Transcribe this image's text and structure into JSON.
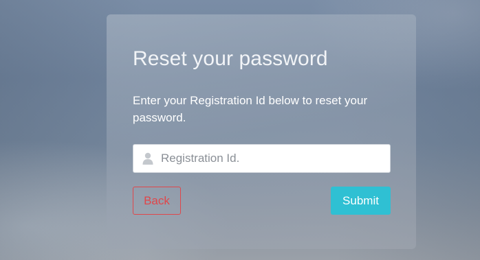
{
  "reset_form": {
    "title": "Reset your password",
    "description": "Enter your Registration Id below to reset your password.",
    "registration_input": {
      "placeholder": "Registration Id.",
      "value": "",
      "icon": "user-icon"
    },
    "back_label": "Back",
    "submit_label": "Submit"
  },
  "colors": {
    "back_button": "#e0464a",
    "submit_button": "#2fc0d3",
    "title_text": "#f2f4f7"
  }
}
